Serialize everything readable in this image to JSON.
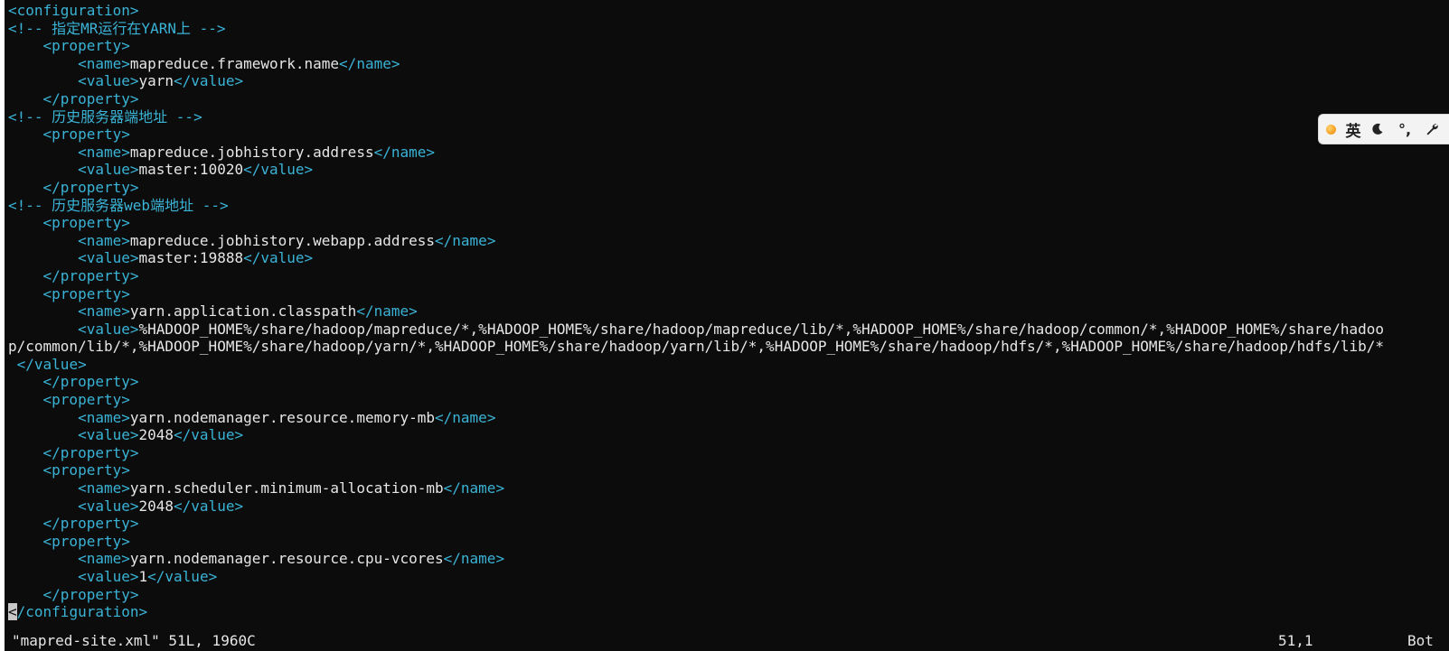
{
  "editor": {
    "lines": [
      [
        {
          "t": "tag",
          "v": "<configuration>"
        }
      ],
      [
        {
          "t": "cmt",
          "v": "<!-- 指定MR运行在YARN上 -->"
        }
      ],
      [
        {
          "t": "txt",
          "v": "    "
        },
        {
          "t": "tag",
          "v": "<property>"
        }
      ],
      [
        {
          "t": "txt",
          "v": "        "
        },
        {
          "t": "tag",
          "v": "<name>"
        },
        {
          "t": "txt",
          "v": "mapreduce.framework.name"
        },
        {
          "t": "tag",
          "v": "</name>"
        }
      ],
      [
        {
          "t": "txt",
          "v": "        "
        },
        {
          "t": "tag",
          "v": "<value>"
        },
        {
          "t": "txt",
          "v": "yarn"
        },
        {
          "t": "tag",
          "v": "</value>"
        }
      ],
      [
        {
          "t": "txt",
          "v": "    "
        },
        {
          "t": "tag",
          "v": "</property>"
        }
      ],
      [
        {
          "t": "cmt",
          "v": "<!-- 历史服务器端地址 -->"
        }
      ],
      [
        {
          "t": "txt",
          "v": "    "
        },
        {
          "t": "tag",
          "v": "<property>"
        }
      ],
      [
        {
          "t": "txt",
          "v": "        "
        },
        {
          "t": "tag",
          "v": "<name>"
        },
        {
          "t": "txt",
          "v": "mapreduce.jobhistory.address"
        },
        {
          "t": "tag",
          "v": "</name>"
        }
      ],
      [
        {
          "t": "txt",
          "v": "        "
        },
        {
          "t": "tag",
          "v": "<value>"
        },
        {
          "t": "txt",
          "v": "master:10020"
        },
        {
          "t": "tag",
          "v": "</value>"
        }
      ],
      [
        {
          "t": "txt",
          "v": "    "
        },
        {
          "t": "tag",
          "v": "</property>"
        }
      ],
      [
        {
          "t": "cmt",
          "v": "<!-- 历史服务器web端地址 -->"
        }
      ],
      [
        {
          "t": "txt",
          "v": "    "
        },
        {
          "t": "tag",
          "v": "<property>"
        }
      ],
      [
        {
          "t": "txt",
          "v": "        "
        },
        {
          "t": "tag",
          "v": "<name>"
        },
        {
          "t": "txt",
          "v": "mapreduce.jobhistory.webapp.address"
        },
        {
          "t": "tag",
          "v": "</name>"
        }
      ],
      [
        {
          "t": "txt",
          "v": "        "
        },
        {
          "t": "tag",
          "v": "<value>"
        },
        {
          "t": "txt",
          "v": "master:19888"
        },
        {
          "t": "tag",
          "v": "</value>"
        }
      ],
      [
        {
          "t": "txt",
          "v": "    "
        },
        {
          "t": "tag",
          "v": "</property>"
        }
      ],
      [
        {
          "t": "txt",
          "v": "    "
        },
        {
          "t": "tag",
          "v": "<property>"
        }
      ],
      [
        {
          "t": "txt",
          "v": "        "
        },
        {
          "t": "tag",
          "v": "<name>"
        },
        {
          "t": "txt",
          "v": "yarn.application.classpath"
        },
        {
          "t": "tag",
          "v": "</name>"
        }
      ],
      [
        {
          "t": "txt",
          "v": "        "
        },
        {
          "t": "tag",
          "v": "<value>"
        },
        {
          "t": "txt",
          "v": "%HADOOP_HOME%/share/hadoop/mapreduce/*,%HADOOP_HOME%/share/hadoop/mapreduce/lib/*,%HADOOP_HOME%/share/hadoop/common/*,%HADOOP_HOME%/share/hadoo"
        }
      ],
      [
        {
          "t": "txt",
          "v": "p/common/lib/*,%HADOOP_HOME%/share/hadoop/yarn/*,%HADOOP_HOME%/share/hadoop/yarn/lib/*,%HADOOP_HOME%/share/hadoop/hdfs/*,%HADOOP_HOME%/share/hadoop/hdfs/lib/*"
        }
      ],
      [
        {
          "t": "txt",
          "v": " "
        },
        {
          "t": "tag",
          "v": "</value>"
        }
      ],
      [
        {
          "t": "txt",
          "v": "    "
        },
        {
          "t": "tag",
          "v": "</property>"
        }
      ],
      [
        {
          "t": "txt",
          "v": "    "
        },
        {
          "t": "tag",
          "v": "<property>"
        }
      ],
      [
        {
          "t": "txt",
          "v": "        "
        },
        {
          "t": "tag",
          "v": "<name>"
        },
        {
          "t": "txt",
          "v": "yarn.nodemanager.resource.memory-mb"
        },
        {
          "t": "tag",
          "v": "</name>"
        }
      ],
      [
        {
          "t": "txt",
          "v": "        "
        },
        {
          "t": "tag",
          "v": "<value>"
        },
        {
          "t": "txt",
          "v": "2048"
        },
        {
          "t": "tag",
          "v": "</value>"
        }
      ],
      [
        {
          "t": "txt",
          "v": "    "
        },
        {
          "t": "tag",
          "v": "</property>"
        }
      ],
      [
        {
          "t": "txt",
          "v": "    "
        },
        {
          "t": "tag",
          "v": "<property>"
        }
      ],
      [
        {
          "t": "txt",
          "v": "        "
        },
        {
          "t": "tag",
          "v": "<name>"
        },
        {
          "t": "txt",
          "v": "yarn.scheduler.minimum-allocation-mb"
        },
        {
          "t": "tag",
          "v": "</name>"
        }
      ],
      [
        {
          "t": "txt",
          "v": "        "
        },
        {
          "t": "tag",
          "v": "<value>"
        },
        {
          "t": "txt",
          "v": "2048"
        },
        {
          "t": "tag",
          "v": "</value>"
        }
      ],
      [
        {
          "t": "txt",
          "v": "    "
        },
        {
          "t": "tag",
          "v": "</property>"
        }
      ],
      [
        {
          "t": "txt",
          "v": "    "
        },
        {
          "t": "tag",
          "v": "<property>"
        }
      ],
      [
        {
          "t": "txt",
          "v": "        "
        },
        {
          "t": "tag",
          "v": "<name>"
        },
        {
          "t": "txt",
          "v": "yarn.nodemanager.resource.cpu-vcores"
        },
        {
          "t": "tag",
          "v": "</name>"
        }
      ],
      [
        {
          "t": "txt",
          "v": "        "
        },
        {
          "t": "tag",
          "v": "<value>"
        },
        {
          "t": "txt",
          "v": "1"
        },
        {
          "t": "tag",
          "v": "</value>"
        }
      ],
      [
        {
          "t": "txt",
          "v": "    "
        },
        {
          "t": "tag",
          "v": "</property>"
        }
      ],
      [
        {
          "t": "cur",
          "v": "<"
        },
        {
          "t": "tag",
          "v": "/configuration>"
        }
      ]
    ]
  },
  "status": {
    "file_info": "\"mapred-site.xml\" 51L, 1960C",
    "cursor_pos": "51,1",
    "scroll": "Bot"
  },
  "ime": {
    "lang_label": "英",
    "punct_label": "°,",
    "icons": [
      "orange-dot-icon",
      "moon-icon",
      "punctuation-icon",
      "wrench-icon"
    ]
  },
  "colors": {
    "background": "#0c0c0c",
    "tag": "#3ab3d6",
    "text": "#e6e6e6"
  }
}
